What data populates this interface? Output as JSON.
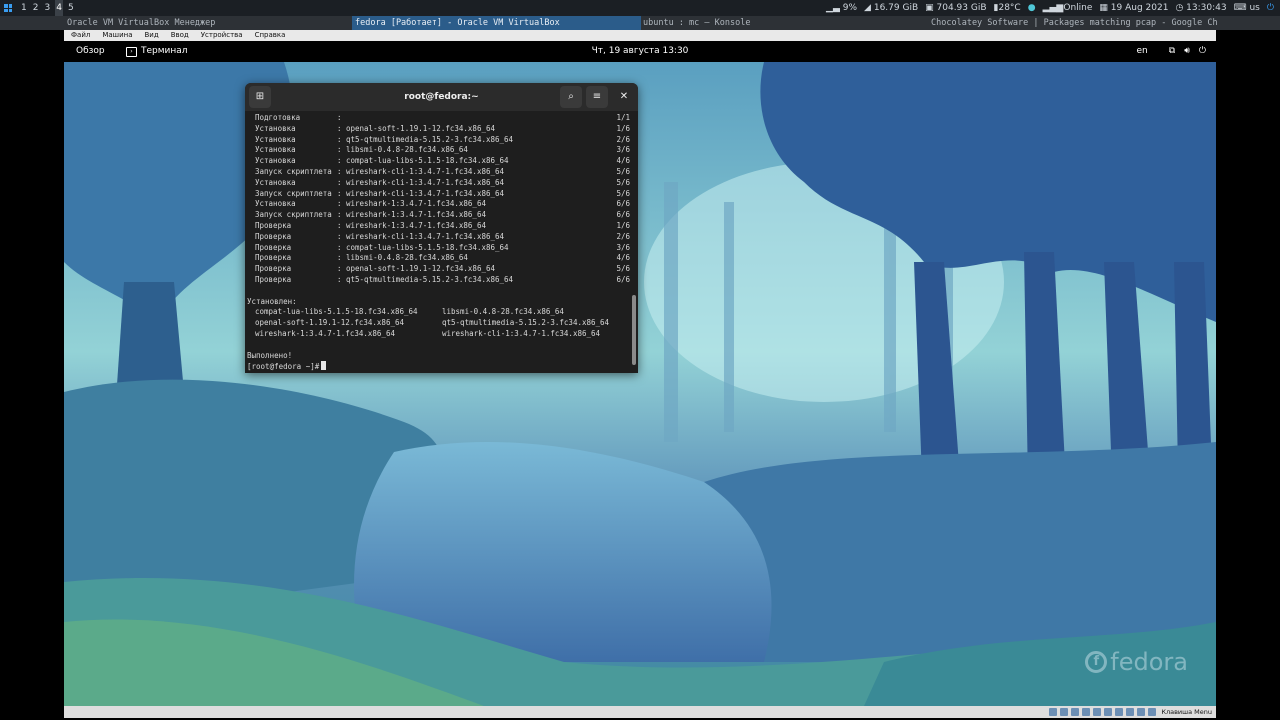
{
  "host_panel": {
    "workspaces": [
      "1",
      "2",
      "3",
      "4",
      "5"
    ],
    "active_workspace": "4",
    "stats": {
      "cpu": "9%",
      "memory": "16.79 GiB",
      "disk": "704.93 GiB",
      "temperature": "28°C",
      "network": "Online",
      "date": "19 Aug 2021",
      "time": "13:30:43",
      "keyboard": "us"
    }
  },
  "host_taskbar": {
    "tasks": [
      "Oracle VM VirtualBox Менеджер",
      "fedora [Работает] - Oracle VM VirtualBox",
      "ubuntu : mc — Konsole",
      "Chocolatey Software | Packages matching pcap - Google Chrome"
    ]
  },
  "vbox_menu": [
    "Файл",
    "Машина",
    "Вид",
    "Ввод",
    "Устройства",
    "Справка"
  ],
  "gnome_bar": {
    "activities": "Обзор",
    "app": "Терминал",
    "clock": "Чт, 19 августа  13:30",
    "lang": "en"
  },
  "terminal": {
    "title": "root@fedora:~",
    "steps": [
      {
        "label": "Подготовка",
        "pkg": "",
        "count": "1/1"
      },
      {
        "label": "Установка",
        "pkg": "openal-soft-1.19.1-12.fc34.x86_64",
        "count": "1/6"
      },
      {
        "label": "Установка",
        "pkg": "qt5-qtmultimedia-5.15.2-3.fc34.x86_64",
        "count": "2/6"
      },
      {
        "label": "Установка",
        "pkg": "libsmi-0.4.8-28.fc34.x86_64",
        "count": "3/6"
      },
      {
        "label": "Установка",
        "pkg": "compat-lua-libs-5.1.5-18.fc34.x86_64",
        "count": "4/6"
      },
      {
        "label": "Запуск скриптлета",
        "pkg": "wireshark-cli-1:3.4.7-1.fc34.x86_64",
        "count": "5/6"
      },
      {
        "label": "Установка",
        "pkg": "wireshark-cli-1:3.4.7-1.fc34.x86_64",
        "count": "5/6"
      },
      {
        "label": "Запуск скриптлета",
        "pkg": "wireshark-cli-1:3.4.7-1.fc34.x86_64",
        "count": "5/6"
      },
      {
        "label": "Установка",
        "pkg": "wireshark-1:3.4.7-1.fc34.x86_64",
        "count": "6/6"
      },
      {
        "label": "Запуск скриптлета",
        "pkg": "wireshark-1:3.4.7-1.fc34.x86_64",
        "count": "6/6"
      },
      {
        "label": "Проверка",
        "pkg": "wireshark-1:3.4.7-1.fc34.x86_64",
        "count": "1/6"
      },
      {
        "label": "Проверка",
        "pkg": "wireshark-cli-1:3.4.7-1.fc34.x86_64",
        "count": "2/6"
      },
      {
        "label": "Проверка",
        "pkg": "compat-lua-libs-5.1.5-18.fc34.x86_64",
        "count": "3/6"
      },
      {
        "label": "Проверка",
        "pkg": "libsmi-0.4.8-28.fc34.x86_64",
        "count": "4/6"
      },
      {
        "label": "Проверка",
        "pkg": "openal-soft-1.19.1-12.fc34.x86_64",
        "count": "5/6"
      },
      {
        "label": "Проверка",
        "pkg": "qt5-qtmultimedia-5.15.2-3.fc34.x86_64",
        "count": "6/6"
      }
    ],
    "installed_header": "Установлен:",
    "installed": [
      [
        "compat-lua-libs-5.1.5-18.fc34.x86_64",
        "libsmi-0.4.8-28.fc34.x86_64"
      ],
      [
        "openal-soft-1.19.1-12.fc34.x86_64",
        "qt5-qtmultimedia-5.15.2-3.fc34.x86_64"
      ],
      [
        "wireshark-1:3.4.7-1.fc34.x86_64",
        "wireshark-cli-1:3.4.7-1.fc34.x86_64"
      ]
    ],
    "done": "Выполнено!",
    "prompt": "[root@fedora ~]#"
  },
  "wallpaper": {
    "logo_text": "fedora"
  },
  "vbox_status": {
    "keyboard_label": "Клавиша Menu"
  }
}
